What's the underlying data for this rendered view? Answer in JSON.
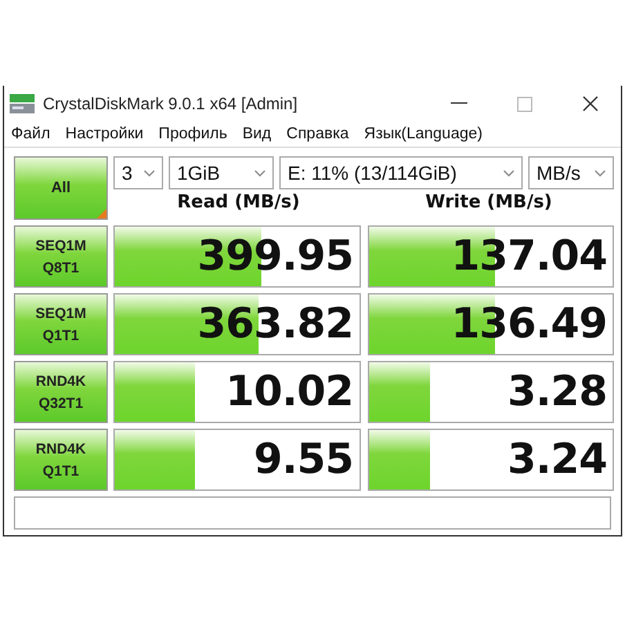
{
  "window": {
    "title": "CrystalDiskMark 9.0.1 x64 [Admin]"
  },
  "menu": [
    "Файл",
    "Настройки",
    "Профиль",
    "Вид",
    "Справка",
    "Язык(Language)"
  ],
  "all_button": "All",
  "selectors": [
    {
      "value": "3"
    },
    {
      "value": "1GiB"
    },
    {
      "value": "E: 11% (13/114GiB)"
    },
    {
      "value": "MB/s"
    }
  ],
  "columns": [
    "Read (MB/s)",
    "Write (MB/s)"
  ],
  "rows": [
    {
      "test": "SEQ1M",
      "params": "Q8T1",
      "read": {
        "value": "399.95",
        "level": 0.6
      },
      "write": {
        "value": "137.04",
        "level": 0.52
      }
    },
    {
      "test": "SEQ1M",
      "params": "Q1T1",
      "read": {
        "value": "363.82",
        "level": 0.59
      },
      "write": {
        "value": "136.49",
        "level": 0.52
      }
    },
    {
      "test": "RND4K",
      "params": "Q32T1",
      "read": {
        "value": "10.02",
        "level": 0.33
      },
      "write": {
        "value": "3.28",
        "level": 0.25
      }
    },
    {
      "test": "RND4K",
      "params": "Q1T1",
      "read": {
        "value": "9.55",
        "level": 0.33
      },
      "write": {
        "value": "3.24",
        "level": 0.25
      }
    }
  ]
}
